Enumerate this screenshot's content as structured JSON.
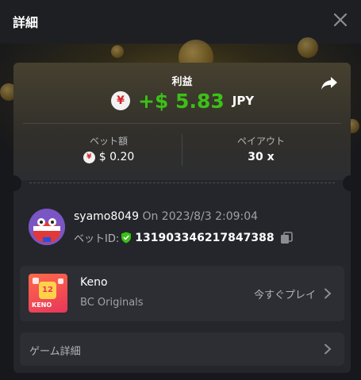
{
  "header": {
    "title": "詳細"
  },
  "profit": {
    "label": "利益",
    "amount": "+$ 5.83",
    "currency": "JPY",
    "currency_symbol": "¥"
  },
  "stats": {
    "bet_amount": {
      "label": "ベット額",
      "value": "$ 0.20",
      "currency_symbol": "¥"
    },
    "payout": {
      "label": "ペイアウト",
      "value": "30 x"
    }
  },
  "bet": {
    "username": "syamo8049",
    "on_text": "On 2023/8/3 2:09:04",
    "bet_id_label": "ベットID:",
    "bet_id": "131903346217847388"
  },
  "game": {
    "name": "Keno",
    "provider": "BC Originals",
    "play_label": "今すぐプレイ",
    "thumb_text": "KENO",
    "thumb_number": "12"
  },
  "details": {
    "label": "ゲーム詳細"
  },
  "colors": {
    "profit_green": "#3bc117",
    "panel": "#24262b",
    "row": "#2c2e33",
    "shield_green": "#3bc117"
  },
  "icons": [
    "close-icon",
    "share-icon",
    "yen-icon",
    "shield-check-icon",
    "copy-icon",
    "chevron-right-icon"
  ]
}
